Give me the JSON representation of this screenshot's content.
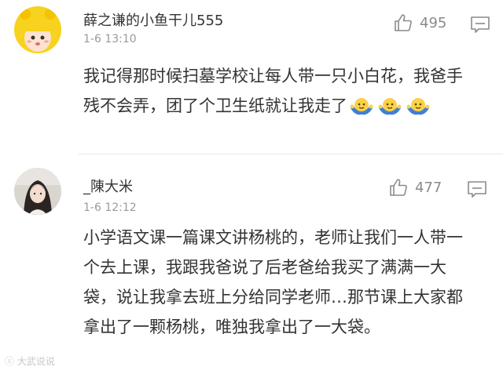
{
  "comments": [
    {
      "username": "薛之谦的小鱼干儿555",
      "time": "1-6 13:10",
      "likes": "495",
      "text": "我记得那时候扫墓学校让每人带一只小白花，我爸手残不会弄，团了个卫生纸就让我走了",
      "emojis": [
        "shrug-emoji",
        "shrug-emoji",
        "shrug-emoji"
      ],
      "avatar": "yellow-hat-avatar-icon"
    },
    {
      "username": "_陳大米",
      "time": "1-6 12:12",
      "likes": "477",
      "text": "小学语文课一篇课文讲杨桃的，老师让我们一人带一个去上课，我跟我爸说了后老爸给我买了满满一大袋，说让我拿去班上分给同学老师…那节课上大家都拿出了一颗杨桃，唯独我拿出了一大袋。",
      "avatar": "girl-photo-avatar-icon"
    }
  ],
  "icons": {
    "like": "thumbs-up-icon",
    "reply": "comment-bubble-icon"
  },
  "colors": {
    "text": "#333333",
    "meta": "#9a9a9a",
    "divider": "#e8e8e8"
  },
  "watermark": "大武说说"
}
